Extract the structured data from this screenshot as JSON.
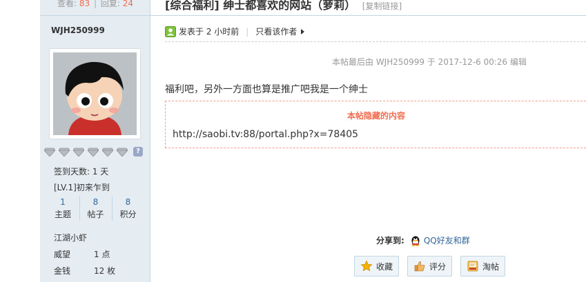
{
  "author": {
    "stats": {
      "views_label": "查看:",
      "views": "83",
      "replies_label": "回复:",
      "replies": "24",
      "separator": "|"
    },
    "name": "WJH250999",
    "signin_days": "签到天数: 1 天",
    "level": "[LV.1]初来乍到",
    "counts": [
      {
        "value": "1",
        "label": "主题"
      },
      {
        "value": "8",
        "label": "帖子"
      },
      {
        "value": "8",
        "label": "积分"
      }
    ],
    "rank": "江湖小虾",
    "attributes": [
      {
        "key": "威望",
        "value": "1 点"
      },
      {
        "key": "金钱",
        "value": "12 枚"
      }
    ],
    "medal_count": 6,
    "help_glyph": "?"
  },
  "thread": {
    "title": "[综合福利] 绅士都喜欢的网站（萝莉）",
    "copy_link": "[复制链接]"
  },
  "post": {
    "posted": "发表于 2 小时前",
    "meta_separator": "|",
    "author_only": "只看该作者",
    "edit_note": "本帖最后由 WJH250999 于 2017-12-6 00:26 编辑",
    "body": "福利吧，另外一方面也算是推广吧我是一个绅士",
    "hidden_title": "本帖隐藏的内容",
    "hidden_url": "http://saobi.tv:88/portal.php?x=78405"
  },
  "share": {
    "label": "分享到:",
    "qq": "QQ好友和群"
  },
  "actions": [
    {
      "label": "收藏",
      "icon": "star-icon"
    },
    {
      "label": "评分",
      "icon": "thumb-icon"
    },
    {
      "label": "淘帖",
      "icon": "tray-icon"
    }
  ],
  "colors": {
    "sidebar_bg": "#e5edf2",
    "border": "#c2d5e3",
    "accent_red": "#f26c4f",
    "link_blue": "#336699"
  }
}
